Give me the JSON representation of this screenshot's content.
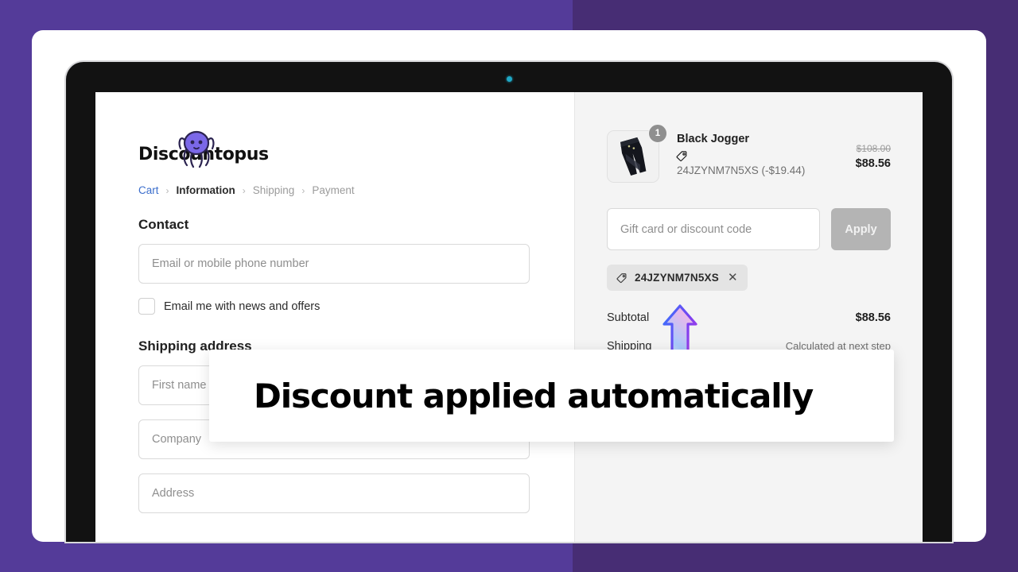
{
  "theme": {
    "bg_left": "#543b99",
    "bg_right": "#472d74",
    "panel_bg": "#f4f4f4",
    "link_blue": "#3b6ecc",
    "accent_purple": "#6c4fd6"
  },
  "device": {
    "camera_icon": "camera-dot"
  },
  "brand": {
    "name": "Discountopus",
    "logo_icon": "octopus-logo"
  },
  "breadcrumb": {
    "separator": "›",
    "items": [
      {
        "label": "Cart",
        "state": "link"
      },
      {
        "label": "Information",
        "state": "current"
      },
      {
        "label": "Shipping",
        "state": "dim"
      },
      {
        "label": "Payment",
        "state": "dim"
      }
    ]
  },
  "contact": {
    "title": "Contact",
    "email_placeholder": "Email or mobile phone number",
    "email_value": "",
    "newsletter_label": "Email me with news and offers",
    "newsletter_checked": false
  },
  "shipping_address": {
    "title": "Shipping address",
    "fields": [
      {
        "name": "first-name",
        "placeholder": "First name (optional)",
        "value": ""
      },
      {
        "name": "company",
        "placeholder": "Company",
        "value": ""
      },
      {
        "name": "address",
        "placeholder": "Address",
        "value": ""
      }
    ]
  },
  "order_summary": {
    "item": {
      "name": "Black Jogger",
      "quantity": "1",
      "discount_icon": "price-tag-icon",
      "discount_text": "24JZYNM7N5XS (-$19.44)",
      "price_original": "$108.00",
      "price_final": "$88.56",
      "thumbnail_icon": "black-jogger-pants-image"
    },
    "discount": {
      "placeholder": "Gift card or discount code",
      "value": "",
      "apply_label": "Apply",
      "chip_code": "24JZYNM7N5XS",
      "chip_icon": "price-tag-icon",
      "chip_remove_icon": "close-icon"
    },
    "totals": [
      {
        "label": "Subtotal",
        "value": "$88.56",
        "muted": false
      },
      {
        "label": "Shipping",
        "value": "Calculated at next step",
        "muted": true
      }
    ]
  },
  "overlay": {
    "caption": "Discount applied automatically",
    "cursor_icon": "up-arrow-cursor"
  }
}
